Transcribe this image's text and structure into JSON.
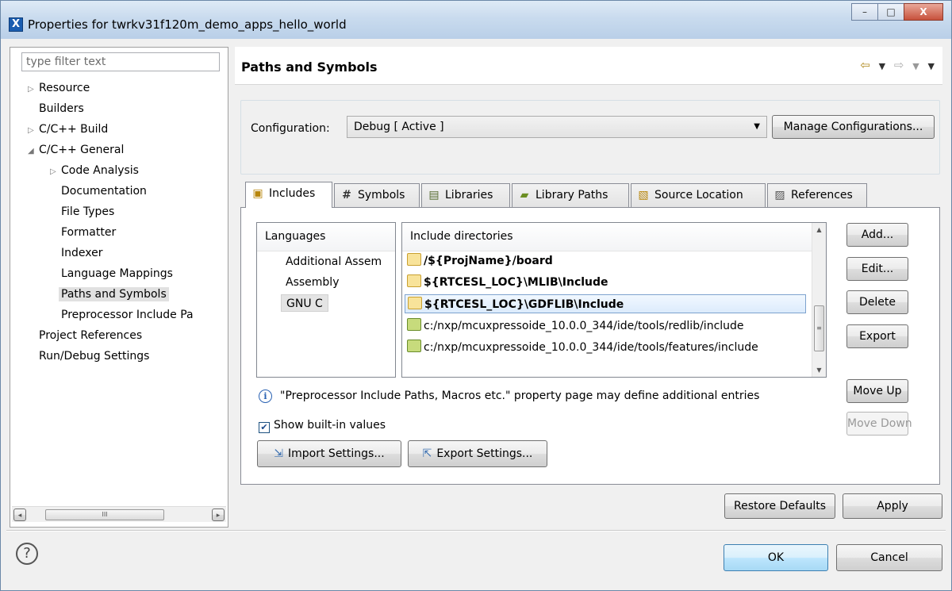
{
  "window": {
    "title": "Properties for twrkv31f120m_demo_apps_hello_world",
    "app_icon": "X",
    "minimize_glyph": "–",
    "maximize_glyph": "□",
    "close_glyph": "X"
  },
  "sidebar": {
    "filter_placeholder": "type filter text",
    "items": [
      {
        "label": "Resource",
        "expander": "▷"
      },
      {
        "label": "Builders",
        "expander": ""
      },
      {
        "label": "C/C++ Build",
        "expander": "▷"
      },
      {
        "label": "C/C++ General",
        "expander": "◢"
      },
      {
        "label": "Code Analysis",
        "expander": "▷"
      },
      {
        "label": "Documentation",
        "expander": ""
      },
      {
        "label": "File Types",
        "expander": ""
      },
      {
        "label": "Formatter",
        "expander": ""
      },
      {
        "label": "Indexer",
        "expander": ""
      },
      {
        "label": "Language Mappings",
        "expander": ""
      },
      {
        "label": "Paths and Symbols",
        "expander": "",
        "selected": true
      },
      {
        "label": "Preprocessor Include Pa",
        "expander": ""
      },
      {
        "label": "Project References",
        "expander": ""
      },
      {
        "label": "Run/Debug Settings",
        "expander": ""
      }
    ],
    "scroll_left": "◂",
    "scroll_right": "▸",
    "scroll_grip": "III"
  },
  "page": {
    "title": "Paths and Symbols",
    "nav_back": "⇦",
    "nav_forward": "⇨",
    "nav_dropdown": "▼",
    "nav_menu": "▼"
  },
  "config": {
    "label": "Configuration:",
    "selected": "Debug  [ Active ]",
    "dropdown_glyph": "▼",
    "manage_button": "Manage Configurations..."
  },
  "tabs": [
    {
      "label": "Includes",
      "icon": "includes-icon",
      "active": true
    },
    {
      "label": "Symbols",
      "icon": "hash-icon",
      "glyph": "#"
    },
    {
      "label": "Libraries",
      "icon": "libraries-icon"
    },
    {
      "label": "Library Paths",
      "icon": "library-paths-icon"
    },
    {
      "label": "Source Location",
      "icon": "source-location-icon"
    },
    {
      "label": "References",
      "icon": "references-icon"
    }
  ],
  "languages": {
    "header": "Languages",
    "items": [
      "Additional Assem",
      "Assembly",
      "GNU C"
    ],
    "selected_index": 2
  },
  "includes": {
    "header": "Include directories",
    "items": [
      {
        "path": "/${ProjName}/board",
        "bold": true,
        "icon": "workspace-folder-icon"
      },
      {
        "path": "${RTCESL_LOC}\\MLIB\\Include",
        "bold": true,
        "icon": "workspace-folder-icon"
      },
      {
        "path": "${RTCESL_LOC}\\GDFLIB\\Include",
        "bold": true,
        "icon": "workspace-folder-icon",
        "selected": true
      },
      {
        "path": "c:/nxp/mcuxpressoide_10.0.0_344/ide/tools/redlib/include",
        "bold": false,
        "icon": "filesystem-folder-icon"
      },
      {
        "path": "c:/nxp/mcuxpressoide_10.0.0_344/ide/tools/features/include",
        "bold": false,
        "icon": "filesystem-folder-icon"
      }
    ],
    "scroll_up": "▲",
    "scroll_down": "▼",
    "scroll_grip": "≡"
  },
  "side_buttons": {
    "add": "Add...",
    "edit": "Edit...",
    "delete": "Delete",
    "export": "Export",
    "move_up": "Move Up",
    "move_down": "Move Down"
  },
  "info": {
    "icon_glyph": "i",
    "text": "\"Preprocessor Include Paths, Macros etc.\" property page may define additional entries"
  },
  "show_builtin": {
    "label": "Show built-in values",
    "checked": true,
    "check_glyph": "✔"
  },
  "settings_buttons": {
    "import": "Import Settings...",
    "export": "Export Settings..."
  },
  "footer": {
    "restore_defaults": "Restore Defaults",
    "apply": "Apply",
    "ok": "OK",
    "cancel": "Cancel",
    "help_glyph": "?"
  },
  "colors": {
    "folder_yellow": "#f8e39a",
    "folder_green": "#c7db7c",
    "selection_blue": "#dcebfc",
    "accent_blue": "#2a62b3"
  }
}
